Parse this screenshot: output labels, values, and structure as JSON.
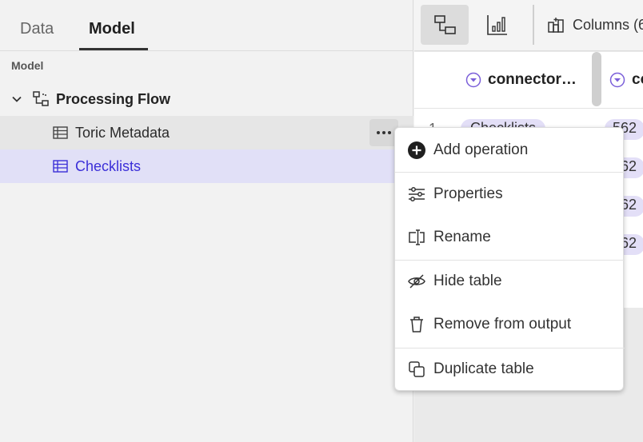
{
  "tabs": {
    "data_label": "Data",
    "model_label": "Model"
  },
  "sidebar": {
    "section_label": "Model",
    "flow": {
      "label": "Processing Flow",
      "icon": "flow-icon"
    },
    "tables": [
      {
        "label": "Toric Metadata",
        "icon": "table-icon"
      },
      {
        "label": "Checklists",
        "icon": "table-icon"
      }
    ]
  },
  "toolbar": {
    "columns_label": "Columns (6"
  },
  "grid": {
    "columns": [
      {
        "header": "connector…"
      },
      {
        "header": "co"
      }
    ],
    "row_number": "1",
    "cells": {
      "first": "Checklists",
      "num_values": [
        "562",
        "562",
        "562",
        "562"
      ]
    }
  },
  "context_menu": {
    "items": [
      {
        "label": "Add operation",
        "icon": "plus-circle-icon"
      },
      {
        "label": "Properties",
        "icon": "sliders-icon"
      },
      {
        "label": "Rename",
        "icon": "rename-icon"
      },
      {
        "label": "Hide table",
        "icon": "eye-off-icon"
      },
      {
        "label": "Remove from output",
        "icon": "trash-icon"
      },
      {
        "label": "Duplicate table",
        "icon": "duplicate-icon"
      }
    ]
  },
  "colors": {
    "accent": "#3b2fd8",
    "selected_row": "#e1e0f7",
    "chip": "#e3dff7",
    "column_arrow": "#7b5fd9"
  }
}
